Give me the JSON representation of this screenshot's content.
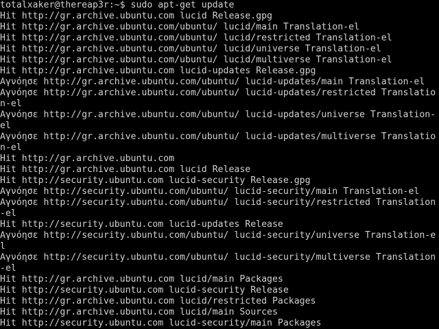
{
  "terminal": {
    "lines": [
      "totalxaker@thereap3r:~$ sudo apt-get update",
      "Hit http://gr.archive.ubuntu.com lucid Release.gpg",
      "Hit http://gr.archive.ubuntu.com/ubuntu/ lucid/main Translation-el",
      "Hit http://gr.archive.ubuntu.com/ubuntu/ lucid/restricted Translation-el",
      "Hit http://gr.archive.ubuntu.com/ubuntu/ lucid/universe Translation-el",
      "Hit http://gr.archive.ubuntu.com/ubuntu/ lucid/multiverse Translation-el",
      "Hit http://gr.archive.ubuntu.com lucid-updates Release.gpg",
      "Αγνόησε http://gr.archive.ubuntu.com/ubuntu/ lucid-updates/main Translation-el",
      "Αγνόησε http://gr.archive.ubuntu.com/ubuntu/ lucid-updates/restricted Translatio",
      "n-el",
      "Αγνόησε http://gr.archive.ubuntu.com/ubuntu/ lucid-updates/universe Translation-",
      "el",
      "Αγνόησε http://gr.archive.ubuntu.com/ubuntu/ lucid-updates/multiverse Translatio",
      "n-el",
      "Hit http://gr.archive.ubuntu.com",
      "Hit http://gr.archive.ubuntu.com lucid Release",
      "Hit http://security.ubuntu.com lucid-security Release.gpg",
      "Αγνόησε http://security.ubuntu.com/ubuntu/ lucid-security/main Translation-el",
      "Αγνόησε http://security.ubuntu.com/ubuntu/ lucid-security/restricted Translation",
      "-el",
      "Hit http://security.ubuntu.com lucid-updates Release",
      "Αγνόησε http://security.ubuntu.com/ubuntu/ lucid-security/universe Translation-e",
      "l",
      "Αγνόησε http://security.ubuntu.com/ubuntu/ lucid-security/multiverse Translation",
      "-el",
      "Hit http://gr.archive.ubuntu.com lucid/main Packages",
      "Hit http://security.ubuntu.com lucid-security Release",
      "Hit http://gr.archive.ubuntu.com lucid/restricted Packages",
      "Hit http://gr.archive.ubuntu.com lucid/main Sources",
      "Hit http://security.ubuntu.com lucid-security/main Packages"
    ]
  }
}
